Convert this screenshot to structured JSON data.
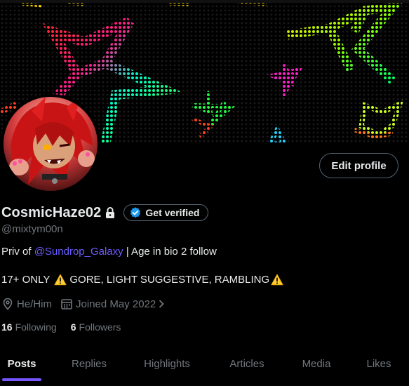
{
  "profile": {
    "display_name": "CosmicHaze02",
    "handle": "@mixtym00n",
    "edit_profile_label": "Edit profile",
    "get_verified_label": "Get verified"
  },
  "bio": {
    "line1_prefix": "Priv of ",
    "line1_mention": "@Sundrop_Galaxy",
    "line1_suffix": " | Age in bio 2 follow",
    "line2_prefix": "17+ ONLY",
    "line2_text": "GORE, LIGHT SUGGESTIVE, RAMBLING"
  },
  "meta": {
    "pronouns": "He/Him",
    "joined": "Joined May 2022"
  },
  "follow": {
    "following_count": "16",
    "following_label": "Following",
    "followers_count": "6",
    "followers_label": "Followers"
  },
  "tabs": [
    {
      "label": "Posts",
      "active": true
    },
    {
      "label": "Replies",
      "active": false
    },
    {
      "label": "Highlights",
      "active": false
    },
    {
      "label": "Articles",
      "active": false
    },
    {
      "label": "Media",
      "active": false
    },
    {
      "label": "Likes",
      "active": false
    }
  ],
  "colors": {
    "accent_tab": "#7856ff",
    "mention": "#6b5cff",
    "verified": "#1d9bf0",
    "warning": "#ffcc33"
  }
}
